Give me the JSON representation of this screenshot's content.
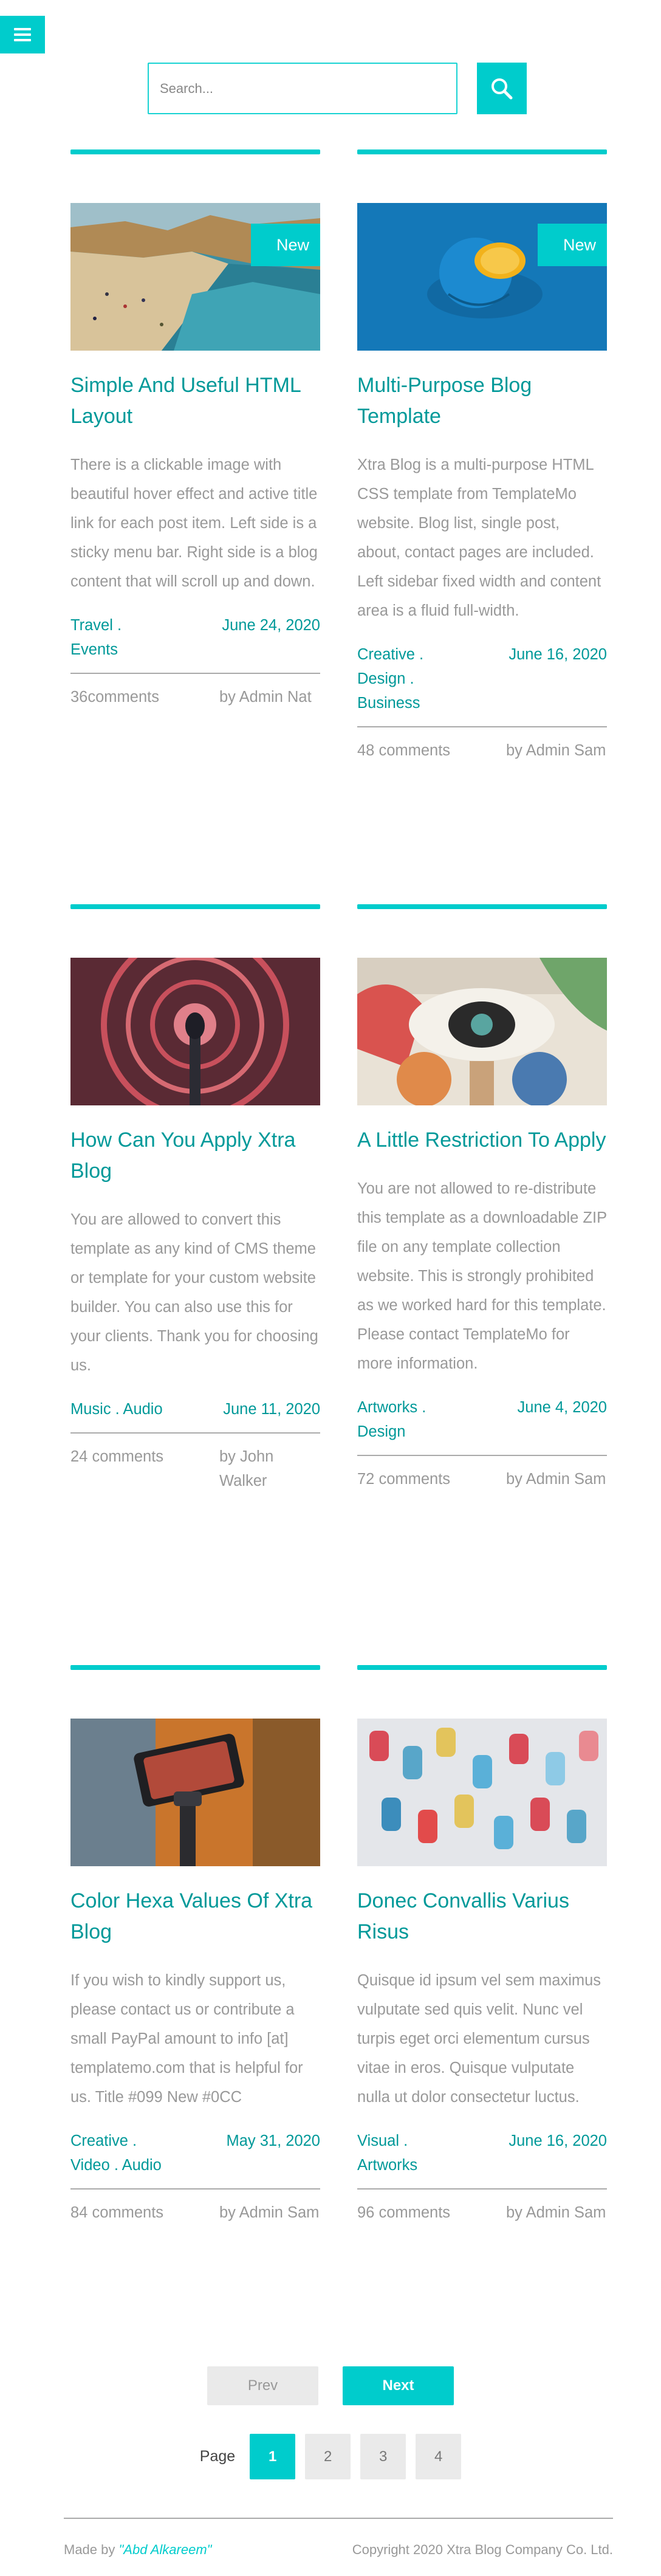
{
  "search": {
    "placeholder": "Search..."
  },
  "accent_color": "#00CCCC",
  "posts": [
    {
      "badge": "New",
      "image": "beach-cove-photo",
      "title": "Simple And Useful HTML Layout",
      "excerpt": "There is a clickable image with beautiful hover effect and active title link for each post item. Left side is a sticky menu bar. Right side is a blog content that will scroll up and down.",
      "categories": [
        "Travel .",
        "Events"
      ],
      "date": "June 24, 2020",
      "comments": "36comments",
      "author": "by Admin Nat"
    },
    {
      "badge": "New",
      "image": "orange-on-blue-photo",
      "title": "Multi-Purpose Blog Template",
      "excerpt": "Xtra Blog is a multi-purpose HTML CSS template from TemplateMo website. Blog list, single post, about, contact pages are included. Left sidebar fixed width and content area is a fluid full-width.",
      "categories": [
        "Creative .",
        "Design .",
        "Business"
      ],
      "date": "June 16, 2020",
      "comments": "48 comments",
      "author": "by Admin Sam"
    },
    {
      "badge": "",
      "image": "microphone-mural-photo",
      "title": "How Can You Apply Xtra Blog",
      "excerpt": "You are allowed to convert this template as any kind of CMS theme or template for your custom website builder. You can also use this for your clients. Thank you for choosing us.",
      "categories": [
        "Music . Audio"
      ],
      "date": "June 11, 2020",
      "comments": "24 comments",
      "author": "by John Walker"
    },
    {
      "badge": "",
      "image": "eye-artwork-photo",
      "title": "A Little Restriction To Apply",
      "excerpt": "You are not allowed to re-distribute this template as a downloadable ZIP file on any template collection website. This is strongly prohibited as we worked hard for this template. Please contact TemplateMo for more information.",
      "categories": [
        "Artworks .",
        "Design"
      ],
      "date": "June 4, 2020",
      "comments": "72 comments",
      "author": "by Admin Sam"
    },
    {
      "badge": "",
      "image": "camera-gimbal-photo",
      "title": "Color Hexa Values Of Xtra Blog",
      "excerpt": "If you wish to kindly support us, please contact us or contribute a small PayPal amount to info [at] templatemo.com that is helpful for us. Title #099 New #0CC",
      "categories": [
        "Creative .",
        "Video . Audio"
      ],
      "date": "May 31, 2020",
      "comments": "84 comments",
      "author": "by Admin Sam"
    },
    {
      "badge": "",
      "image": "paper-lanterns-photo",
      "title": "Donec Convallis Varius Risus",
      "excerpt": "Quisque id ipsum vel sem maximus vulputate sed quis velit. Nunc vel turpis eget orci elementum cursus vitae in eros. Quisque vulputate nulla ut dolor consectetur luctus.",
      "categories": [
        "Visual .",
        "Artworks"
      ],
      "date": "June 16, 2020",
      "comments": "96 comments",
      "author": "by Admin Sam"
    }
  ],
  "pagination": {
    "prev": "Prev",
    "next": "Next",
    "page_label": "Page",
    "pages": [
      "1",
      "2",
      "3",
      "4"
    ],
    "active": "1"
  },
  "footer": {
    "credit_prefix": "Made by ",
    "credit_name": "\"Abd Alkareem\"",
    "copyright": "Copyright 2020 Xtra Blog Company Co. Ltd."
  }
}
